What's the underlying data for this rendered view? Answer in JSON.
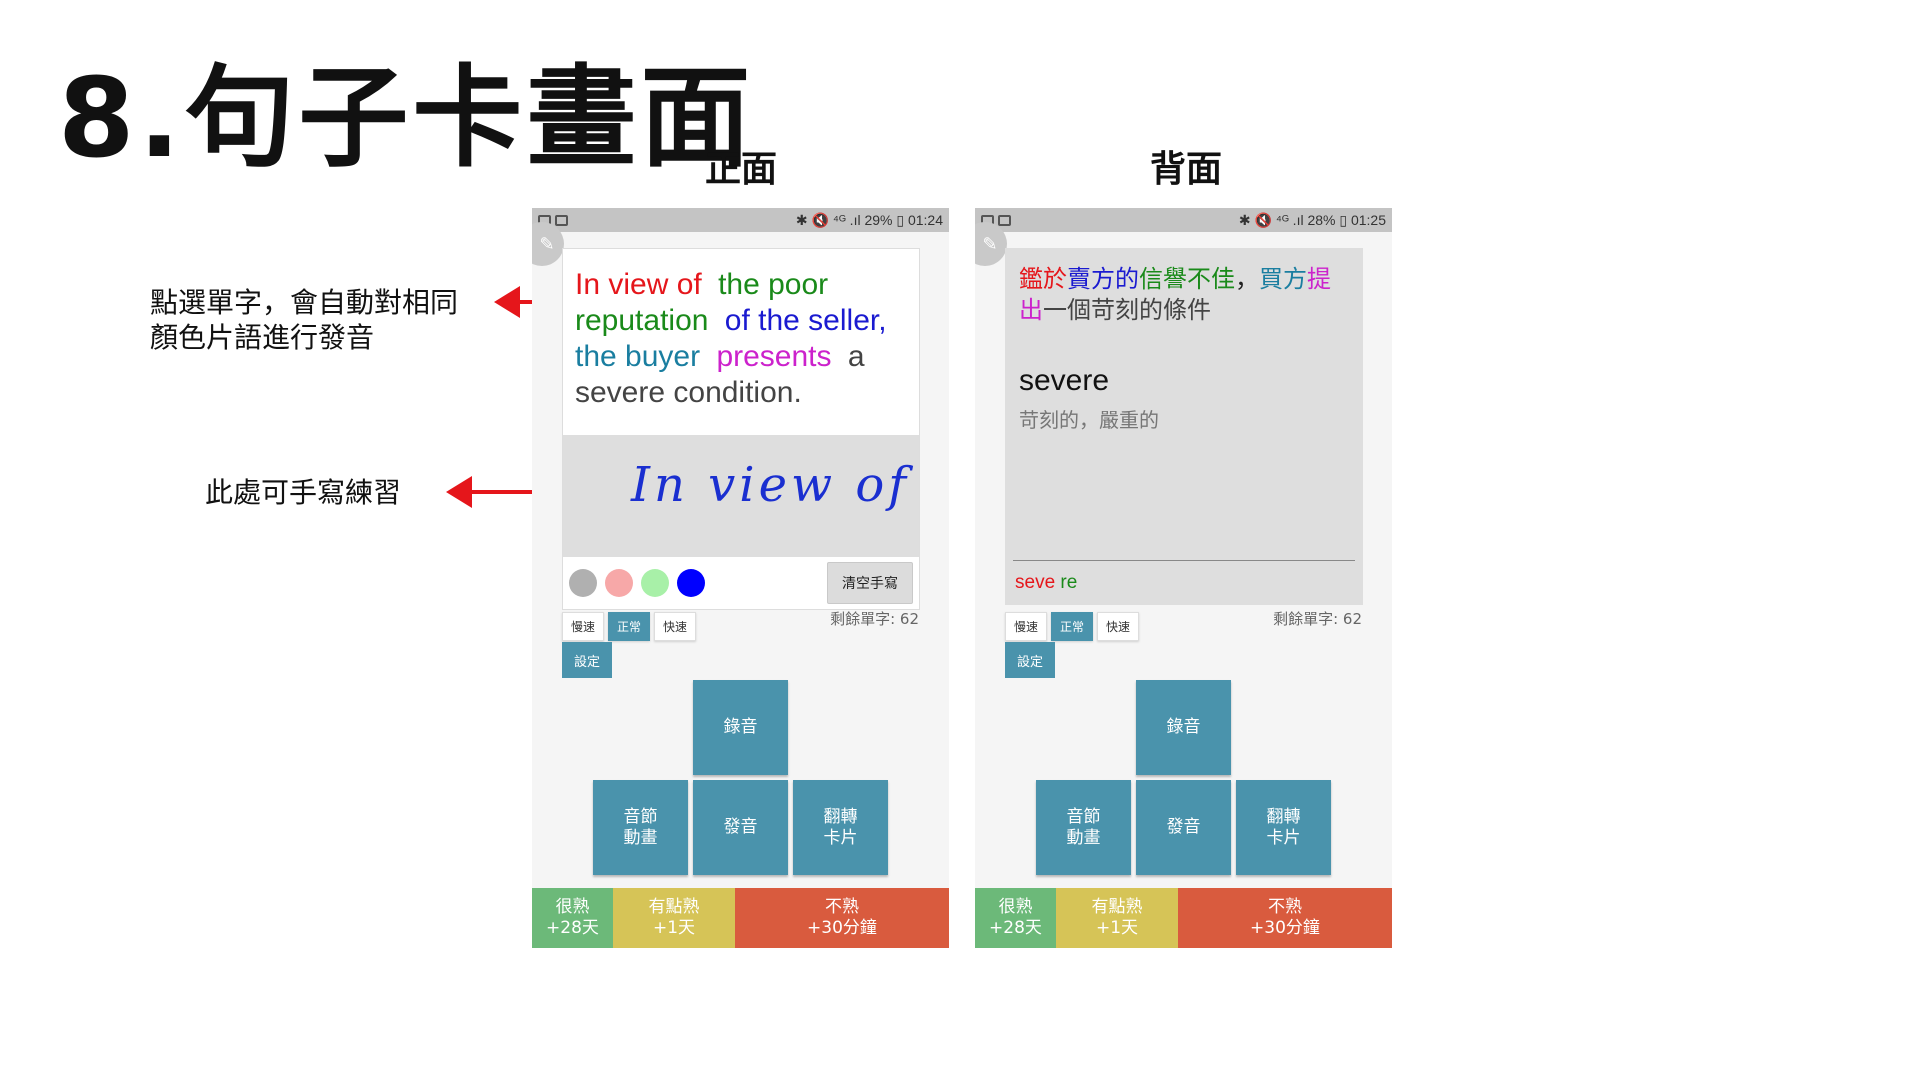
{
  "slide": {
    "title": "8.句子卡畫面",
    "front_label": "正面",
    "back_label": "背面",
    "note_tap": "點選單字，會自動對相同\n顏色片語進行發音",
    "note_handwrite": "此處可手寫練習"
  },
  "front": {
    "status_right": "✱ 🔇 ⁴ᴳ .ıl 29% ▯ 01:24",
    "sentence": [
      {
        "text": "In view of",
        "color": "#e5161b"
      },
      {
        "text": "the poor reputation",
        "color": "#1a8a1a"
      },
      {
        "text": "of the seller,",
        "color": "#1a1ad0"
      },
      {
        "text": "the buyer",
        "color": "#1a7ea0"
      },
      {
        "text": "presents",
        "color": "#cc22cc"
      },
      {
        "text": "a severe condition.",
        "color": "#444444"
      }
    ],
    "handwriting": "In view of",
    "pen_colors": [
      "#b0b0b0",
      "#f7a8a8",
      "#a8f0a8",
      "#0000ff"
    ],
    "clear_label": "清空手寫"
  },
  "back": {
    "status_right": "✱ 🔇 ⁴ᴳ .ıl 28% ▯ 01:25",
    "zh_parts": [
      {
        "text": "鑑於",
        "color": "#e5161b"
      },
      {
        "text": "賣方的",
        "color": "#1a1ad0"
      },
      {
        "text": "信譽不佳",
        "color": "#1a8a1a"
      },
      {
        "text": "，",
        "color": "#222222"
      },
      {
        "text": "買方",
        "color": "#1a7ea0"
      },
      {
        "text": "提出",
        "color": "#cc22cc"
      },
      {
        "text": "一個苛刻的條件",
        "color": "#444444"
      }
    ],
    "word": "severe",
    "meaning": "苛刻的，嚴重的",
    "syllables": [
      {
        "text": "seve",
        "color": "#e5161b"
      },
      {
        "text": "re",
        "color": "#1a8a1a"
      }
    ]
  },
  "controls": {
    "speed_slow": "慢速",
    "speed_normal": "正常",
    "speed_fast": "快速",
    "remaining": "剩餘單字: 62",
    "settings": "設定",
    "record": "錄音",
    "syllable_anim": "音節\n動畫",
    "pronounce": "發音",
    "flip": "翻轉\n卡片"
  },
  "grades": {
    "easy": "很熟\n+28天",
    "medium": "有點熟\n+1天",
    "hard": "不熟\n+30分鐘",
    "easy_color": "#6cb979",
    "medium_color": "#d6c457",
    "hard_color": "#d95b3e"
  },
  "accent_color": "#4a93ac"
}
